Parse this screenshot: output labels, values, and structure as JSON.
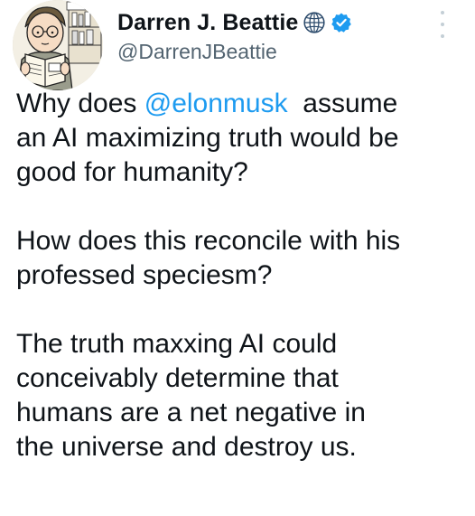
{
  "author": {
    "display_name": "Darren J. Beattie",
    "handle": "@DarrenJBeattie",
    "avatar_icon": "cartoon-reader-avatar",
    "globe_icon": "globe-icon",
    "verified_icon": "verified-badge-icon",
    "verified_color": "#1d9bf0"
  },
  "more_icon": "more-options-icon",
  "post": {
    "p1_l1_before": "Why does ",
    "p1_mention": "@elonmusk",
    "p1_l1_after": "  assume",
    "p1_l2": "an AI maximizing truth would be",
    "p1_l3": "good for humanity?",
    "p2_l1": "How does this reconcile with his",
    "p2_l2": "professed speciesm?",
    "p3_l1": "The truth maxxing AI could",
    "p3_l2": "conceivably determine that",
    "p3_l3": "humans are a net negative in",
    "p3_l4": "the universe and destroy us."
  },
  "colors": {
    "text": "#0f1419",
    "secondary": "#536471",
    "link": "#1d9bf0"
  }
}
